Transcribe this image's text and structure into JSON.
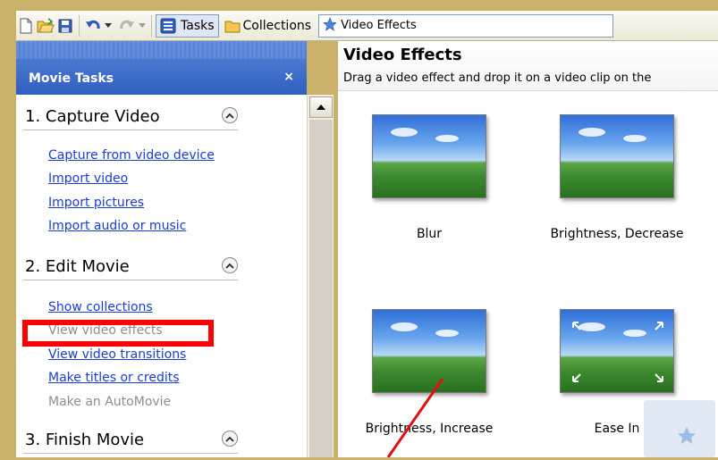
{
  "toolbar": {
    "tasks_label": "Tasks",
    "collections_label": "Collections",
    "collection_selected": "Video Effects"
  },
  "task_pane": {
    "title": "Movie Tasks",
    "close_glyph": "×",
    "sections": [
      {
        "title": "1. Capture Video",
        "links": [
          {
            "label": "Capture from video device",
            "enabled": true
          },
          {
            "label": "Import video",
            "enabled": true
          },
          {
            "label": "Import pictures",
            "enabled": true
          },
          {
            "label": "Import audio or music",
            "enabled": true
          }
        ]
      },
      {
        "title": "2. Edit Movie",
        "links": [
          {
            "label": "Show collections",
            "enabled": true
          },
          {
            "label": "View video effects",
            "enabled": false
          },
          {
            "label": "View video transitions",
            "enabled": true
          },
          {
            "label": "Make titles or credits",
            "enabled": true
          },
          {
            "label": "Make an AutoMovie",
            "enabled": false
          }
        ]
      },
      {
        "title": "3. Finish Movie",
        "links": []
      }
    ]
  },
  "content": {
    "title": "Video Effects",
    "subtitle": "Drag a video effect and drop it on a video clip on the",
    "effects": [
      {
        "label": "Blur"
      },
      {
        "label": "Brightness, Decrease"
      },
      {
        "label": "Brightness, Increase"
      },
      {
        "label": "Ease In"
      }
    ]
  },
  "colors": {
    "frame": "#c9b06b",
    "link": "#1a3dd6",
    "disabled_link": "#8e8e8e",
    "highlight": "#ff0000",
    "task_header": "#2f5fbf"
  },
  "icons": [
    "new-project-icon",
    "open-icon",
    "save-icon",
    "undo-icon",
    "redo-icon",
    "tasks-icon",
    "collections-folder-icon",
    "star-icon",
    "collapse-chevron-icon",
    "scroll-up-icon"
  ]
}
